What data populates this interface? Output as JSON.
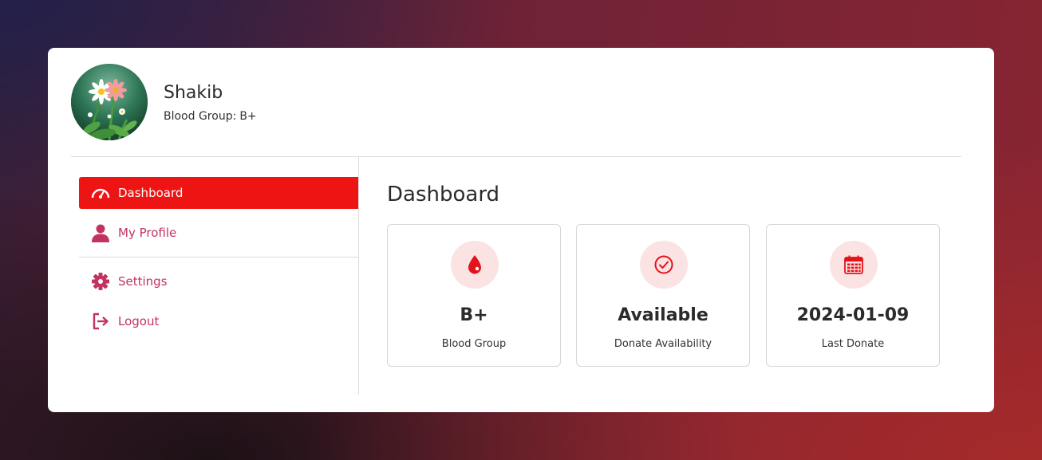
{
  "user": {
    "name": "Shakib",
    "blood_group_label": "Blood Group:",
    "blood_group_value": "B+"
  },
  "sidebar": {
    "items": [
      {
        "label": "Dashboard",
        "icon": "gauge-icon",
        "active": true
      },
      {
        "label": "My Profile",
        "icon": "user-icon",
        "active": false
      },
      {
        "label": "Settings",
        "icon": "gear-icon",
        "active": false
      },
      {
        "label": "Logout",
        "icon": "logout-icon",
        "active": false
      }
    ]
  },
  "main": {
    "title": "Dashboard",
    "stats": [
      {
        "value": "B+",
        "label": "Blood Group",
        "icon": "blood-drop-icon"
      },
      {
        "value": "Available",
        "label": "Donate Availability",
        "icon": "check-circle-icon"
      },
      {
        "value": "2024-01-09",
        "label": "Last Donate",
        "icon": "calendar-icon"
      }
    ]
  },
  "colors": {
    "accent": "#ee1414",
    "nav_text": "#c2335f",
    "icon_bg": "#fbe3e3"
  }
}
